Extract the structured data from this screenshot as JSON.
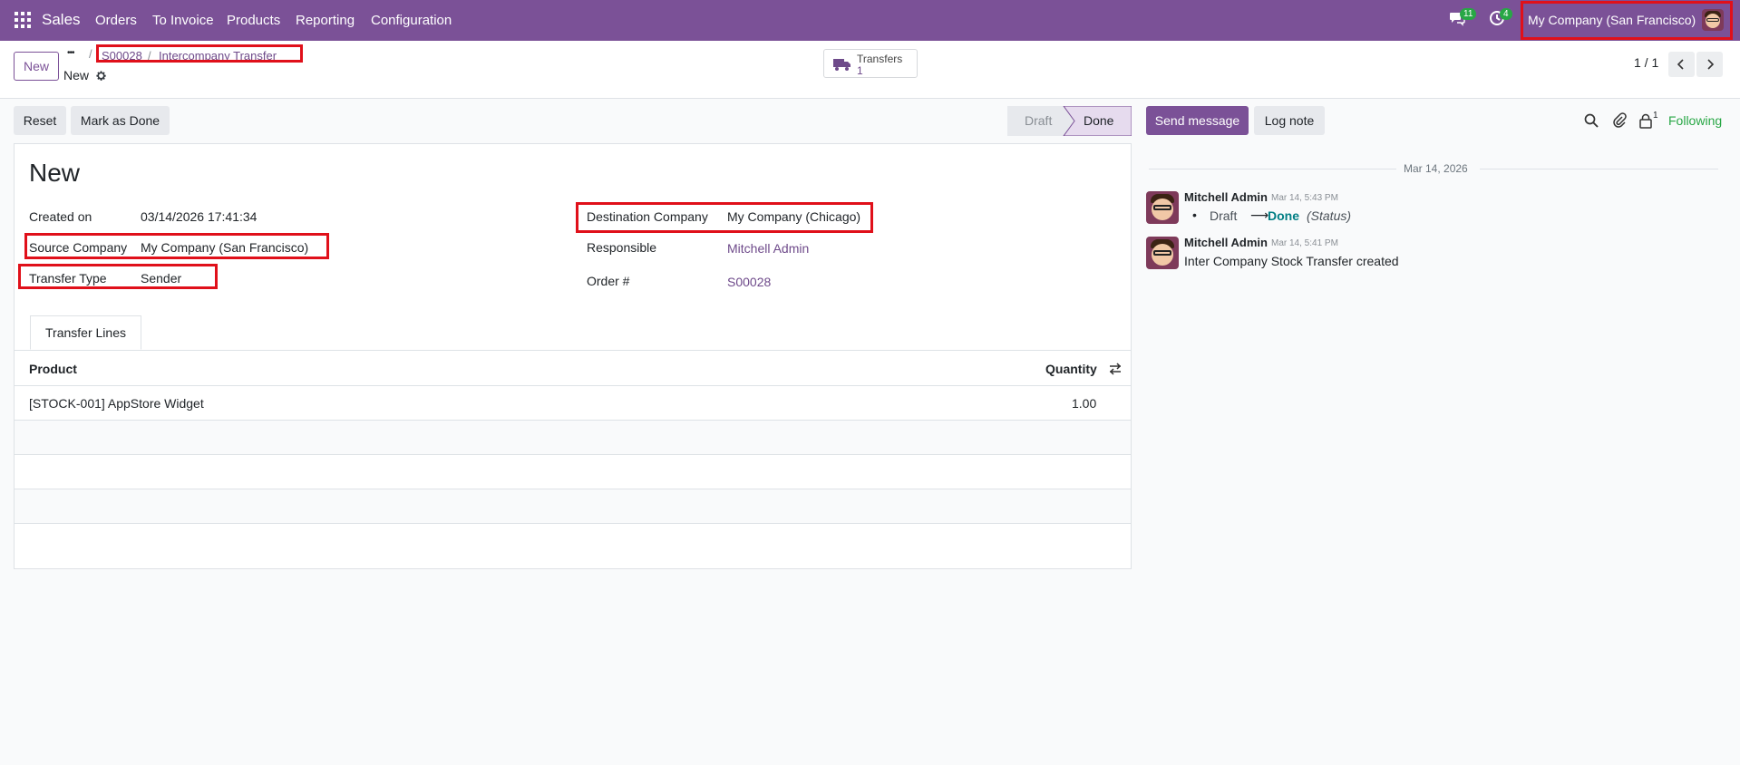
{
  "navbar": {
    "app_name": "Sales",
    "menu": [
      "Orders",
      "To Invoice",
      "Products",
      "Reporting",
      "Configuration"
    ],
    "messages_count": "11",
    "activities_count": "4",
    "company": "My Company (San Francisco)"
  },
  "control_panel": {
    "new_button": "New",
    "breadcrumb_more": "•••",
    "breadcrumb_order": "S00028",
    "breadcrumb_sep": "/",
    "breadcrumb_current": "Intercompany Transfer",
    "record_name": "New",
    "stat_button": {
      "label": "Transfers",
      "value": "1"
    },
    "pager": "1 / 1"
  },
  "actions": {
    "reset": "Reset",
    "mark_done": "Mark as Done",
    "statusbar": [
      "Draft",
      "Done"
    ],
    "active_status": "Done"
  },
  "form": {
    "title": "New",
    "created_on_label": "Created on",
    "created_on": "03/14/2026 17:41:34",
    "source_company_label": "Source Company",
    "source_company": "My Company (San Francisco)",
    "transfer_type_label": "Transfer Type",
    "transfer_type": "Sender",
    "destination_company_label": "Destination Company",
    "destination_company": "My Company (Chicago)",
    "responsible_label": "Responsible",
    "responsible": "Mitchell Admin",
    "order_label": "Order #",
    "order": "S00028",
    "tab_label": "Transfer Lines",
    "columns": {
      "product": "Product",
      "quantity": "Quantity"
    },
    "lines": [
      {
        "product": "[STOCK-001] AppStore Widget",
        "quantity": "1.00"
      }
    ]
  },
  "chatter": {
    "send_message": "Send message",
    "log_note": "Log note",
    "followers_count": "1",
    "following": "Following",
    "date_separator": "Mar 14, 2026",
    "messages": [
      {
        "author": "Mitchell Admin",
        "time": "Mar 14, 5:43 PM",
        "old": "Draft",
        "arrow": "⟶",
        "new": "Done",
        "field": "(Status)"
      },
      {
        "author": "Mitchell Admin",
        "time": "Mar 14, 5:41 PM",
        "body": "Inter Company Stock Transfer created"
      }
    ]
  }
}
